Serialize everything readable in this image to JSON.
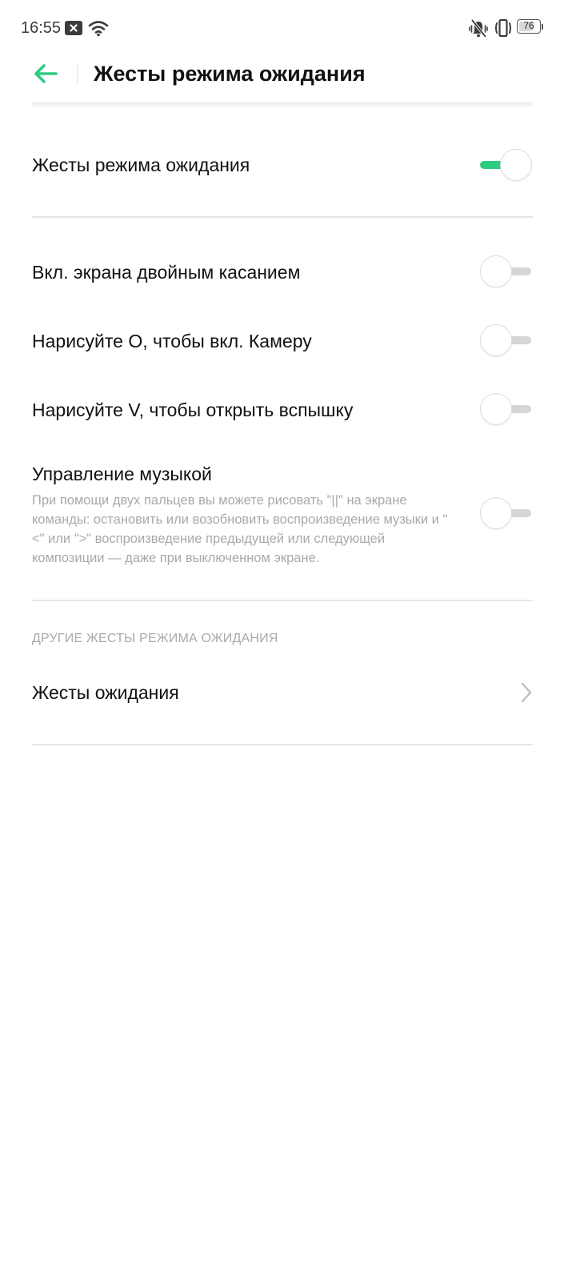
{
  "status_bar": {
    "time": "16:55",
    "battery_level": "76",
    "battery_fraction": 0.76,
    "icons": [
      "notification-x-icon",
      "wifi-icon",
      "mute-icon",
      "vibrate-icon",
      "battery-icon"
    ]
  },
  "header": {
    "back_icon": "back-arrow-icon",
    "title": "Жесты режима ожидания"
  },
  "master": {
    "label": "Жесты режима ожидания",
    "enabled": true
  },
  "gestures": [
    {
      "label": "Вкл. экрана двойным касанием",
      "enabled": false
    },
    {
      "label": "Нарисуйте O, чтобы вкл. Камеру",
      "enabled": false
    },
    {
      "label": "Нарисуйте V, чтобы открыть вспышку",
      "enabled": false
    },
    {
      "label": "Управление музыкой",
      "summary": "При помощи двух пальцев вы можете рисовать \"||\" на экране команды: остановить или возобновить воспроизведение музыки и \"<\" или \">\" воспроизведение предыдущей или следующей композиции — даже при выключенном экране.",
      "enabled": false
    }
  ],
  "other": {
    "section_title": "ДРУГИЕ ЖЕСТЫ РЕЖИМА ОЖИДАНИЯ",
    "item_label": "Жесты ожидания",
    "item_icon": "chevron-right-icon"
  },
  "colors": {
    "accent": "#2ecb82",
    "text_primary": "#111111",
    "text_secondary": "#a9a9a9",
    "divider": "#e6e6e6"
  }
}
